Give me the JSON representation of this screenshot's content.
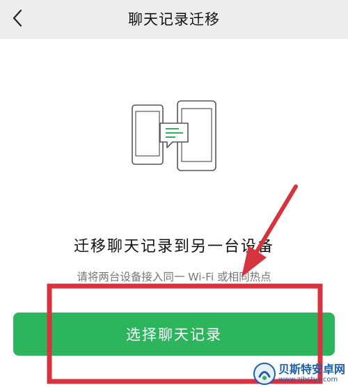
{
  "header": {
    "title": "聊天记录迁移",
    "back_icon": "chevron-left-icon"
  },
  "illustration": {
    "icon": "phone-to-phone-transfer-icon",
    "accent_color": "#2db55d"
  },
  "main": {
    "title": "迁移聊天记录到另一台设备",
    "subtitle": "请将两台设备接入同一 Wi-Fi 或相同热点"
  },
  "action": {
    "select_label": "选择聊天记录",
    "color": "#2db55d"
  },
  "annotation": {
    "color": "#d6333f",
    "shapes": [
      "arrow",
      "box"
    ]
  },
  "watermark": {
    "name": "贝斯特安卓网",
    "url": "www.zjbstyy.com"
  }
}
